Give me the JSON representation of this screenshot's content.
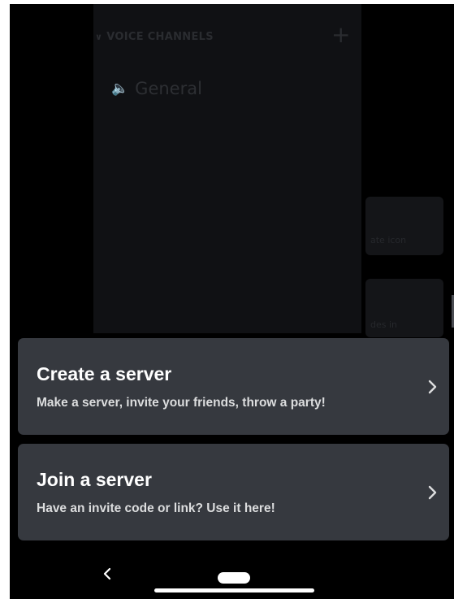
{
  "background": {
    "section_header": "VOICE CHANNELS",
    "channel_name": "General",
    "peek_text_1": "ate icon",
    "peek_text_2": "des in"
  },
  "actions": [
    {
      "title": "Create a server",
      "subtitle": "Make a server, invite your friends, throw a party!"
    },
    {
      "title": "Join a server",
      "subtitle": "Have an invite code or link? Use it here!"
    }
  ],
  "icons": {
    "row_arrow": "chevron-right-icon",
    "nav_back": "back-icon",
    "nav_home": "home-pill-icon"
  },
  "colors": {
    "card_background": "#36393f",
    "scrim": "#000000",
    "title_text": "#ffffff",
    "subtitle_text": "#dcddde"
  }
}
